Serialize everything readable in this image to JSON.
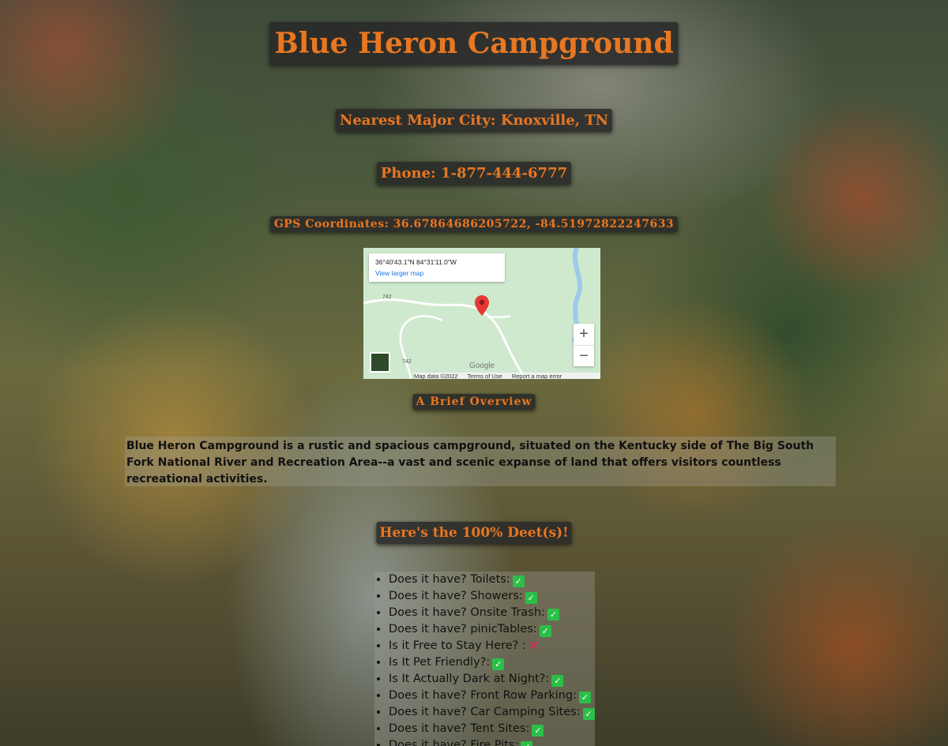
{
  "header": {
    "title": "Blue Heron Campground",
    "nearest_city": "Nearest Major City: Knoxville, TN",
    "phone": "Phone: 1-877-444-6777",
    "gps": "GPS Coordinates: 36.67864686205722, -84.51972822247633"
  },
  "map": {
    "coord_label": "36°40'43.1\"N 84°31'11.0\"W",
    "larger_map_link": "View larger map",
    "zoom_in": "+",
    "zoom_out": "−",
    "logo": "Google",
    "footer": [
      "Map data ©2022",
      "Terms of Use",
      "Report a map error"
    ],
    "road_labels": [
      "742",
      "742"
    ]
  },
  "overview": {
    "heading": "A Brief Overview",
    "text": "Blue Heron Campground is a rustic and spacious campground, situated on the Kentucky side of The Big South Fork National River and Recreation Area--a vast and scenic expanse of land that offers visitors countless recreational activities."
  },
  "details": {
    "heading": "Here's the 100% Deet(s)!",
    "items": [
      {
        "label": "Does it have? Toilets:",
        "icon": "check-icon",
        "value": true
      },
      {
        "label": "Does it have? Showers:",
        "icon": "check-icon",
        "value": true
      },
      {
        "label": "Does it have? Onsite Trash:",
        "icon": "check-icon",
        "value": true
      },
      {
        "label": "Does it have? pinicTables:",
        "icon": "check-icon",
        "value": true
      },
      {
        "label": "Is it Free to Stay Here? :",
        "icon": "cross-icon",
        "value": false
      },
      {
        "label": "Is It Pet Friendly?:",
        "icon": "check-icon",
        "value": true
      },
      {
        "label": "Is It Actually Dark at Night?:",
        "icon": "check-icon",
        "value": true
      },
      {
        "label": "Does it have? Front Row Parking:",
        "icon": "check-icon",
        "value": true
      },
      {
        "label": "Does it have? Car Camping Sites:",
        "icon": "check-icon",
        "value": true
      },
      {
        "label": "Does it have? Tent Sites:",
        "icon": "check-icon",
        "value": true
      },
      {
        "label": "Does it have? Fire Pits:",
        "icon": "check-icon",
        "value": true
      }
    ]
  },
  "colors": {
    "accent": "#e87722",
    "header_bg": "#282828",
    "check": "#2bbf48",
    "cross": "#e0245e"
  }
}
